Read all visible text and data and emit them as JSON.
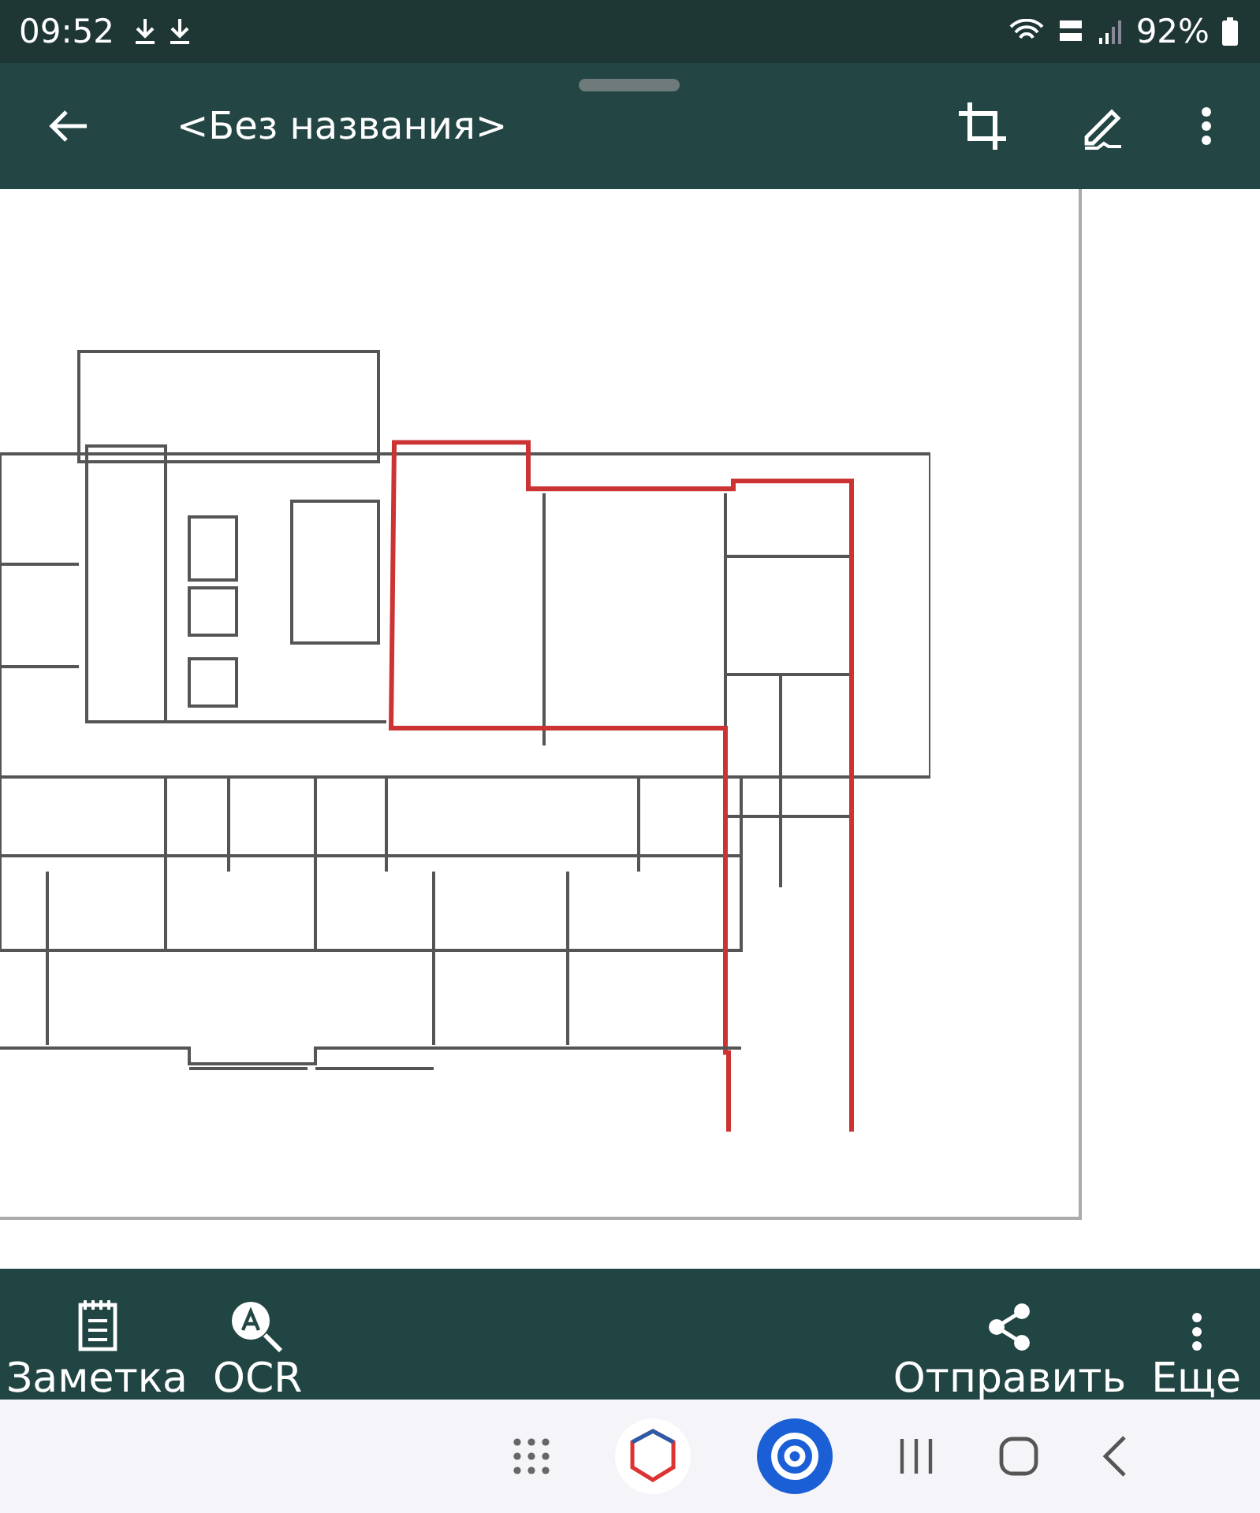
{
  "status_bar": {
    "time": "09:52",
    "battery": "92%"
  },
  "toolbar": {
    "title": "<Без названия>"
  },
  "bottom_actions": [
    {
      "label": "Заметка",
      "kind": "note"
    },
    {
      "label": "OCR",
      "kind": "ocr"
    },
    {
      "label": "Отправить",
      "kind": "share"
    },
    {
      "label": "Еще",
      "kind": "more"
    }
  ]
}
